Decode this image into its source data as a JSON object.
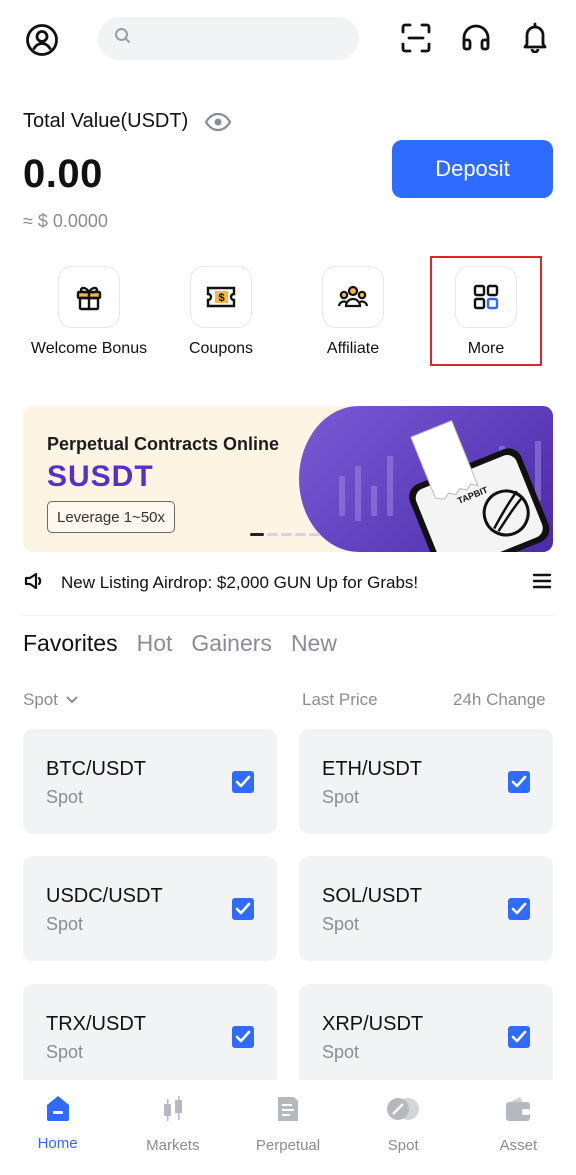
{
  "header": {
    "search_placeholder": "",
    "icons": [
      "profile-icon",
      "search-icon",
      "scan-icon",
      "support-icon",
      "bell-icon"
    ]
  },
  "balance": {
    "label": "Total Value(USDT)",
    "value": "0.00",
    "fiat": "≈ $ 0.0000",
    "deposit_label": "Deposit"
  },
  "shortcuts": [
    {
      "label": "Welcome Bonus",
      "icon": "gift-icon"
    },
    {
      "label": "Coupons",
      "icon": "coupon-icon"
    },
    {
      "label": "Affiliate",
      "icon": "affiliate-icon"
    },
    {
      "label": "More",
      "icon": "grid-icon"
    }
  ],
  "banner": {
    "title": "Perpetual Contracts Online",
    "headline": "SUSDT",
    "pill": "Leverage 1~50x",
    "ticket_text": "Perpetual Contracts Online",
    "brand": "TAPBIT"
  },
  "notice": {
    "text": "New Listing Airdrop: $2,000 GUN Up for Grabs!"
  },
  "tabs": [
    "Favorites",
    "Hot",
    "Gainers",
    "New"
  ],
  "list_header": {
    "market": "Spot",
    "last_price": "Last Price",
    "change": "24h Change"
  },
  "favorites": [
    {
      "pair": "BTC/USDT",
      "type": "Spot",
      "checked": true
    },
    {
      "pair": "ETH/USDT",
      "type": "Spot",
      "checked": true
    },
    {
      "pair": "USDC/USDT",
      "type": "Spot",
      "checked": true
    },
    {
      "pair": "SOL/USDT",
      "type": "Spot",
      "checked": true
    },
    {
      "pair": "TRX/USDT",
      "type": "Spot",
      "checked": true
    },
    {
      "pair": "XRP/USDT",
      "type": "Spot",
      "checked": true
    }
  ],
  "bottom_nav": [
    {
      "label": "Home",
      "active": true
    },
    {
      "label": "Markets",
      "active": false
    },
    {
      "label": "Perpetual",
      "active": false
    },
    {
      "label": "Spot",
      "active": false
    },
    {
      "label": "Asset",
      "active": false
    }
  ],
  "colors": {
    "accent": "#2f6bff",
    "highlight_box": "#e0242b",
    "banner_purple": "#5a2fc9"
  }
}
